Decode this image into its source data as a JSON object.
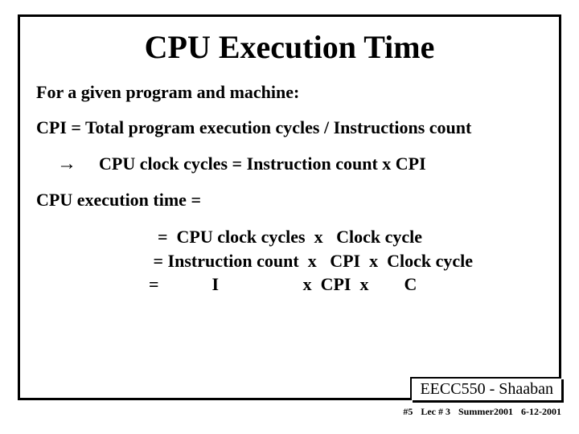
{
  "title": "CPU Execution Time",
  "subtitle": "For a given program and machine:",
  "cpi_def": "CPI =  Total program execution cycles / Instructions count",
  "derived": "CPU clock cycles  =   Instruction count  x  CPI",
  "exec_lead": "CPU execution time  =",
  "eq1": "  =  CPU clock cycles  x   Clock cycle",
  "eq2": " = Instruction count  x   CPI  x  Clock cycle",
  "eq3": "=            I                   x  CPI  x        C",
  "course": "EECC550 - Shaaban",
  "footer": {
    "slide": "#5",
    "lec": "Lec # 3",
    "term": "Summer2001",
    "date": "6-12-2001"
  }
}
